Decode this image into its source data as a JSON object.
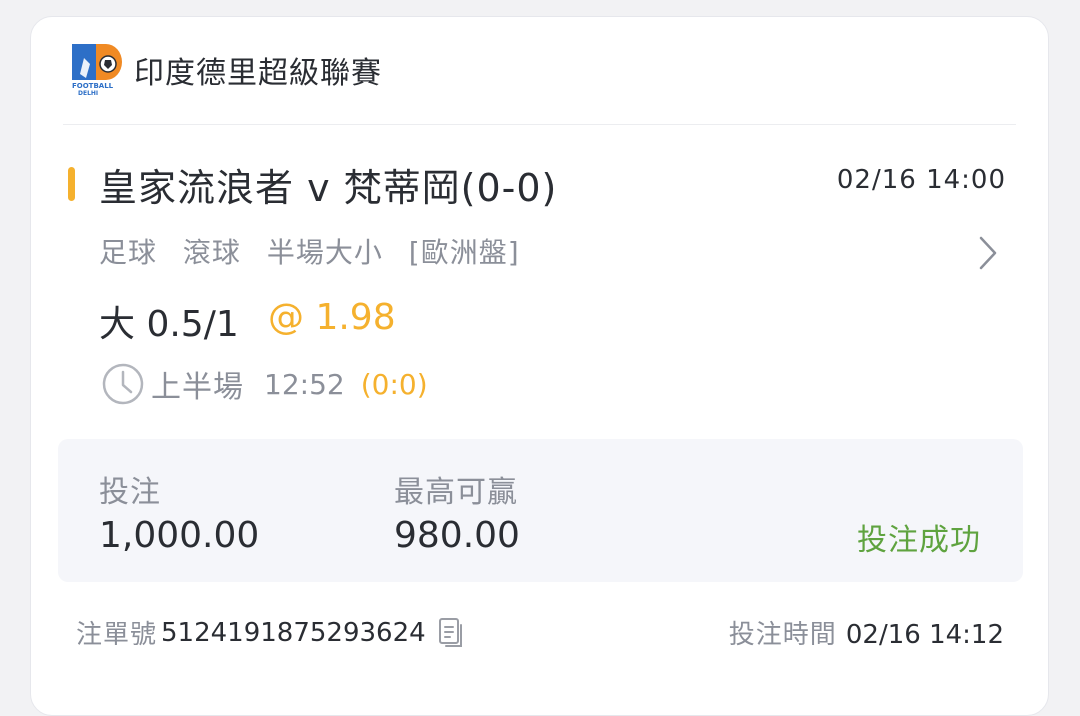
{
  "league": {
    "logo_name": "football-delhi-logo",
    "name": "印度德里超級聯賽"
  },
  "match": {
    "title": "皇家流浪者 v 梵蒂岡(0-0)",
    "time": "02/16 14:00",
    "bet_type": [
      "足球",
      "滾球",
      "半場大小",
      "[歐洲盤]"
    ],
    "selection": "大 0.5/1",
    "odds": "@ 1.98",
    "period": "上半場",
    "period_time": "12:52",
    "period_score": "(0:0)"
  },
  "summary": {
    "stake_label": "投注",
    "stake_value": "1,000.00",
    "max_win_label": "最高可贏",
    "max_win_value": "980.00",
    "status": "投注成功"
  },
  "footer": {
    "ticket_label": "注單號",
    "ticket_value": "5124191875293624",
    "bet_time_label": "投注時間",
    "bet_time_value": "02/16 14:12"
  },
  "colors": {
    "accent": "#f5b12e",
    "success": "#5fa33f",
    "muted": "#8b8f99",
    "text": "#2a2d33"
  },
  "icons": [
    "football-delhi-logo",
    "clock-icon",
    "chevron-right-icon",
    "copy-icon"
  ]
}
